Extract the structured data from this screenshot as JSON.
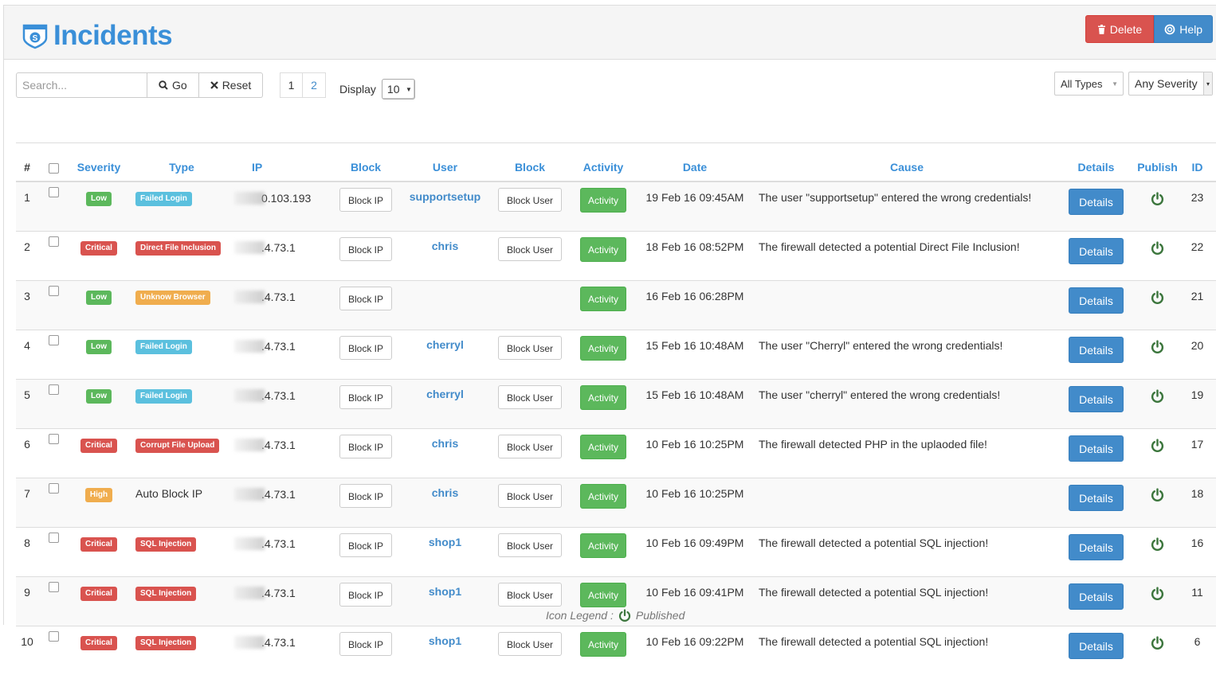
{
  "header": {
    "title": "Incidents",
    "delete_label": "Delete",
    "help_label": "Help"
  },
  "toolbar": {
    "search_placeholder": "Search...",
    "go_label": "Go",
    "reset_label": "Reset",
    "pages": [
      "1",
      "2"
    ],
    "display_label": "Display",
    "display_value": "10"
  },
  "filters": {
    "types": "All Types",
    "severity": "Any Severity"
  },
  "columns": {
    "num": "#",
    "severity": "Severity",
    "type": "Type",
    "ip": "IP",
    "block_ip": "Block",
    "user": "User",
    "block_user": "Block",
    "activity": "Activity",
    "date": "Date",
    "cause": "Cause",
    "details": "Details",
    "publish": "Publish",
    "id": "ID"
  },
  "colors": {
    "low": "#5cb85c",
    "critical": "#d9534f",
    "high": "#f0ad4e",
    "info": "#5bc0de",
    "warning": "#f0ad4e",
    "danger": "#d9534f",
    "primary": "#428bca"
  },
  "labels": {
    "block_ip": "Block IP",
    "block_user": "Block User",
    "activity": "Activity",
    "details": "Details"
  },
  "rows": [
    {
      "num": "1",
      "severity": "Low",
      "sev_class": "low",
      "type": "Failed Login",
      "type_color": "#5bc0de",
      "type_badge": true,
      "ip": "0.103.193",
      "user": "supportsetup",
      "date": "19 Feb 16 09:45AM",
      "cause": "The user \"supportsetup\" entered the wrong credentials!",
      "id": "23"
    },
    {
      "num": "2",
      "severity": "Critical",
      "sev_class": "critical",
      "type": "Direct File Inclusion",
      "type_color": "#d9534f",
      "type_badge": true,
      "ip": ".4.73.1",
      "user": "chris",
      "date": "18 Feb 16 08:52PM",
      "cause": "The firewall detected a potential Direct File Inclusion!",
      "id": "22"
    },
    {
      "num": "3",
      "severity": "Low",
      "sev_class": "low",
      "type": "Unknow Browser",
      "type_color": "#f0ad4e",
      "type_badge": true,
      "ip": ".4.73.1",
      "user": "",
      "date": "16 Feb 16 06:28PM",
      "cause": "",
      "id": "21"
    },
    {
      "num": "4",
      "severity": "Low",
      "sev_class": "low",
      "type": "Failed Login",
      "type_color": "#5bc0de",
      "type_badge": true,
      "ip": ".4.73.1",
      "user": "cherryl",
      "date": "15 Feb 16 10:48AM",
      "cause": "The user \"Cherryl\" entered the wrong credentials!",
      "id": "20"
    },
    {
      "num": "5",
      "severity": "Low",
      "sev_class": "low",
      "type": "Failed Login",
      "type_color": "#5bc0de",
      "type_badge": true,
      "ip": ".4.73.1",
      "user": "cherryl",
      "date": "15 Feb 16 10:48AM",
      "cause": "The user \"cherryl\" entered the wrong credentials!",
      "id": "19"
    },
    {
      "num": "6",
      "severity": "Critical",
      "sev_class": "critical",
      "type": "Corrupt File Upload",
      "type_color": "#d9534f",
      "type_badge": true,
      "ip": ".4.73.1",
      "user": "chris",
      "date": "10 Feb 16 10:25PM",
      "cause": "The firewall detected PHP in the uplaoded file!",
      "id": "17"
    },
    {
      "num": "7",
      "severity": "High",
      "sev_class": "high",
      "type": "Auto Block IP",
      "type_color": "",
      "type_badge": false,
      "ip": ".4.73.1",
      "user": "chris",
      "date": "10 Feb 16 10:25PM",
      "cause": "",
      "id": "18"
    },
    {
      "num": "8",
      "severity": "Critical",
      "sev_class": "critical",
      "type": "SQL Injection",
      "type_color": "#d9534f",
      "type_badge": true,
      "ip": ".4.73.1",
      "user": "shop1",
      "date": "10 Feb 16 09:49PM",
      "cause": "The firewall detected a potential SQL injection!",
      "id": "16"
    },
    {
      "num": "9",
      "severity": "Critical",
      "sev_class": "critical",
      "type": "SQL Injection",
      "type_color": "#d9534f",
      "type_badge": true,
      "ip": ".4.73.1",
      "user": "shop1",
      "date": "10 Feb 16 09:41PM",
      "cause": "The firewall detected a potential SQL injection!",
      "id": "11"
    },
    {
      "num": "10",
      "severity": "Critical",
      "sev_class": "critical",
      "type": "SQL Injection",
      "type_color": "#d9534f",
      "type_badge": true,
      "ip": ".4.73.1",
      "user": "shop1",
      "date": "10 Feb 16 09:22PM",
      "cause": "The firewall detected a potential SQL injection!",
      "id": "6"
    }
  ],
  "legend": {
    "label": "Icon Legend :",
    "published": "Published"
  }
}
